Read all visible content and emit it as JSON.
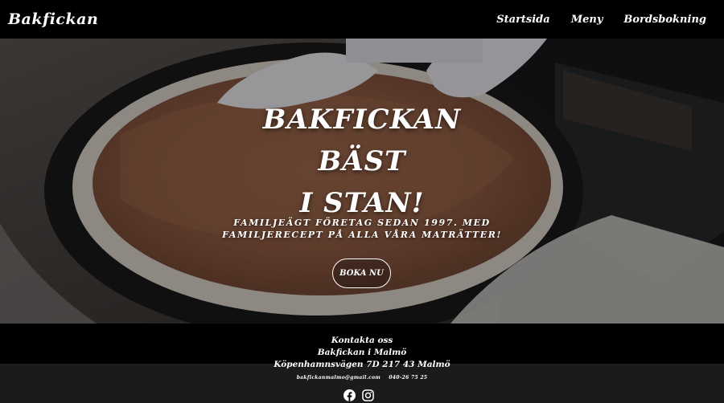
{
  "navbar": {
    "brand": "Bakfickan",
    "links": [
      "Startsida",
      "Meny",
      "Bordsbokning"
    ]
  },
  "hero": {
    "title_lines": [
      "BAKFICKAN",
      "BÄST",
      "I STAN!"
    ],
    "tagline": "FAMILJEÄGT FÖRETAG SEDAN 1997. MED FAMILJERECEPT PÅ ALLA VÅRA MATRÄTTER!",
    "cta_label": "BOKA NU"
  },
  "footer": {
    "heading": "Kontakta oss",
    "name": "Bakfickan i Malmö",
    "address": "Köpenhamnsvägen 7D 217 43 Malmö",
    "email": "bakfickanmalmo@gmail.com",
    "phone": "040-26 75 25",
    "social_icons": [
      "facebook-icon",
      "instagram-icon"
    ]
  },
  "colors": {
    "background": "#000000",
    "text": "#ffffff",
    "footer_band": "#1b1b1b"
  }
}
